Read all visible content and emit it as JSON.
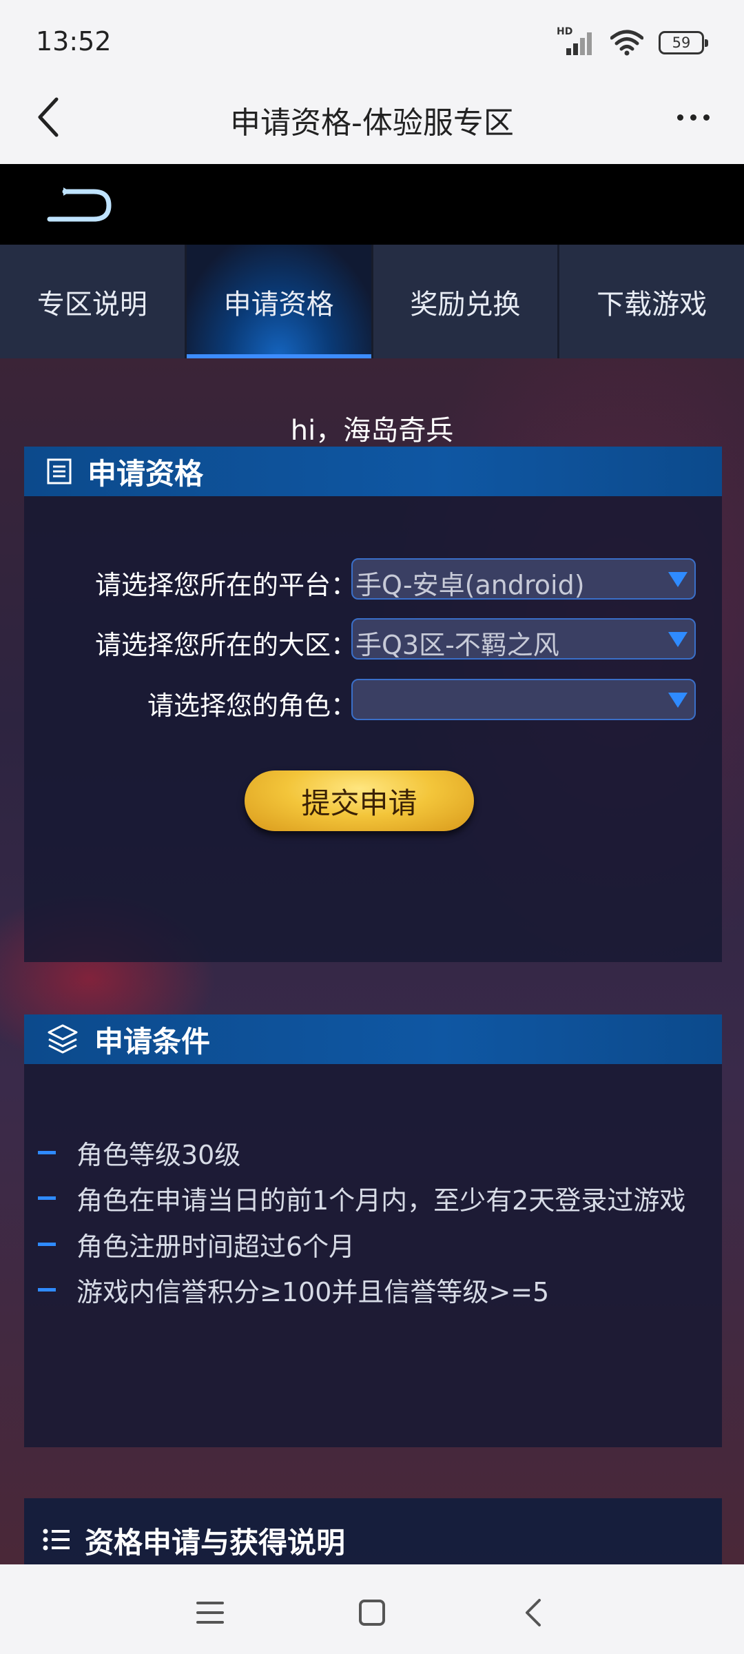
{
  "status_bar": {
    "time": "13:52",
    "network_label": "HD",
    "battery": "59",
    "icons": [
      "signal-icon",
      "wifi-icon",
      "battery-icon"
    ]
  },
  "header": {
    "title": "申请资格-体验服专区",
    "back_icon": "chevron-left-icon",
    "more_icon": "more-dots-icon"
  },
  "banner": {
    "logo_icon": "return-arrow-icon"
  },
  "tabs": [
    {
      "label": "专区说明",
      "active": false
    },
    {
      "label": "申请资格",
      "active": true
    },
    {
      "label": "奖励兑换",
      "active": false
    },
    {
      "label": "下载游戏",
      "active": false
    }
  ],
  "greeting": "hi，海岛奇兵",
  "apply_panel": {
    "title": "申请资格",
    "icon": "document-icon",
    "rows": [
      {
        "label": "请选择您所在的平台：",
        "value": "手Q-安卓(android)"
      },
      {
        "label": "请选择您所在的大区：",
        "value": "手Q3区-不羁之风"
      },
      {
        "label": "请选择您的角色：",
        "value": ""
      }
    ],
    "submit_label": "提交申请"
  },
  "conditions_panel": {
    "title": "申请条件",
    "icon": "layers-icon",
    "items": [
      "角色等级30级",
      "角色在申请当日的前1个月内，至少有2天登录过游戏",
      "角色注册时间超过6个月",
      "游戏内信誉积分≥100并且信誉等级>=5"
    ]
  },
  "info_panel": {
    "title": "资格申请与获得说明",
    "icon": "list-icon"
  },
  "nav": {
    "icons": [
      "menu-icon",
      "home-square-icon",
      "back-icon"
    ]
  },
  "colors": {
    "accent_blue": "#2f8bff",
    "panel_header": "#0f57a3",
    "button_gold": "#f3c53a"
  }
}
